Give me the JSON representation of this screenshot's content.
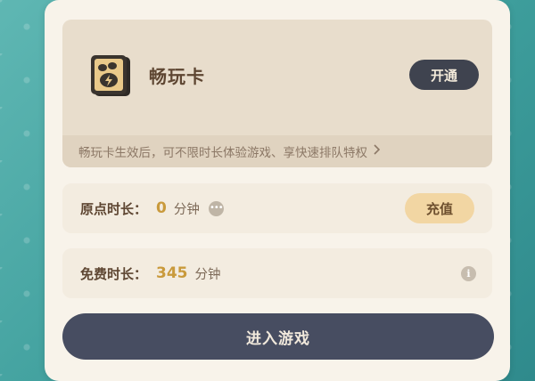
{
  "pass_card": {
    "title": "畅玩卡",
    "open_label": "开通",
    "description": "畅玩卡生效后，可不限时长体验游戏、享快速排队特权",
    "icon": "pass-card-icon"
  },
  "balance": {
    "label": "原点时长：",
    "value": "0",
    "unit": "分钟",
    "more_icon": "ellipsis-icon",
    "recharge_label": "充值"
  },
  "free_time": {
    "label": "免费时长：",
    "value": "345",
    "unit": "分钟",
    "info_icon": "info-icon"
  },
  "enter_label": "进入游戏",
  "colors": {
    "background": "#3e9e9c",
    "panel": "#f8f3ea",
    "dark_button": "#474d61",
    "recharge_button": "#f2d6a3",
    "value_gold": "#c99a3c"
  }
}
